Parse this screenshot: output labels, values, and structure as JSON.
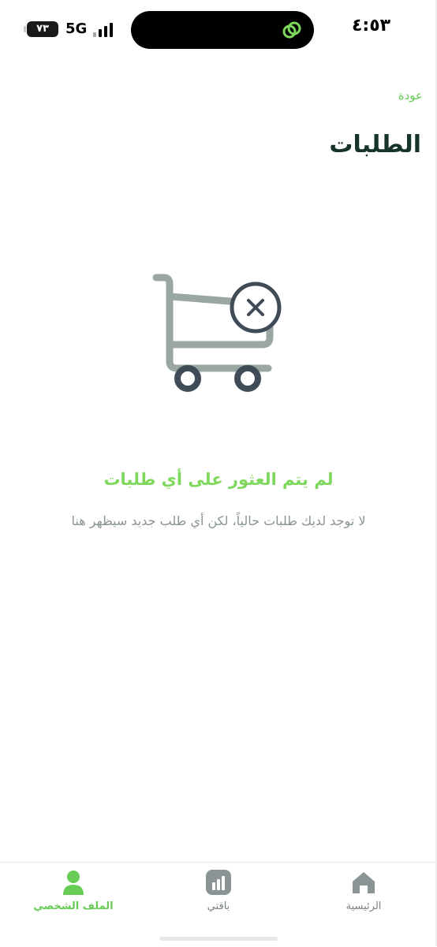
{
  "status_bar": {
    "time": "٤:٥٣",
    "network": "5G",
    "battery": "٧٣"
  },
  "header": {
    "back_label": "عودة",
    "title": "الطلبات"
  },
  "empty_state": {
    "title": "لم يتم العثور على أي طلبات",
    "subtitle": "لا توجد لديك طلبات حالياً، لكن أي طلب جديد سيظهر هنا"
  },
  "bottom_nav": {
    "items": [
      {
        "label": "الرئيسية",
        "icon": "home-icon",
        "active": false
      },
      {
        "label": "باقتي",
        "icon": "bar-chart-icon",
        "active": false
      },
      {
        "label": "الملف الشخصي",
        "icon": "profile-icon",
        "active": true
      }
    ]
  },
  "colors": {
    "accent": "#7dd85c",
    "title_text": "#16342a",
    "muted_text": "#8a9494",
    "cart_gray": "#9aa6a4",
    "cart_dark": "#3f4b57"
  }
}
